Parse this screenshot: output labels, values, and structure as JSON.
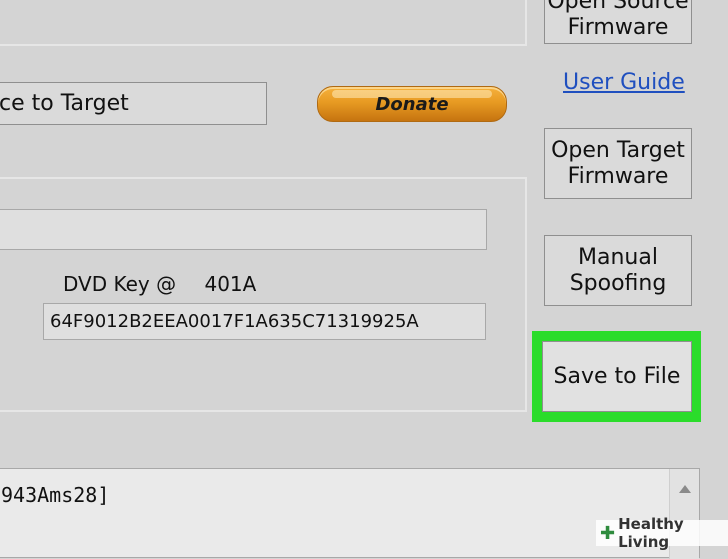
{
  "buttons": {
    "open_source_firmware_1": "Open Source",
    "open_source_firmware_2": "Firmware",
    "device_to_target": "ce to Target",
    "donate": "Donate",
    "open_target_firmware_1": "Open Target",
    "open_target_firmware_2": "Firmware",
    "manual_spoofing_1": "Manual",
    "manual_spoofing_2": "Spoofing",
    "save_to_file": "Save to File"
  },
  "links": {
    "user_guide": "User Guide"
  },
  "dvd_key": {
    "label": "DVD Key @",
    "address": "401A",
    "value": "64F9012B2EEA0017F1A635C71319925A"
  },
  "log": {
    "text": "943Ams28]"
  },
  "watermark": {
    "text": "Healthy Living"
  },
  "colors": {
    "highlight": "#2bdc2b",
    "link": "#1f4fbf",
    "donate": "#e79a22"
  }
}
